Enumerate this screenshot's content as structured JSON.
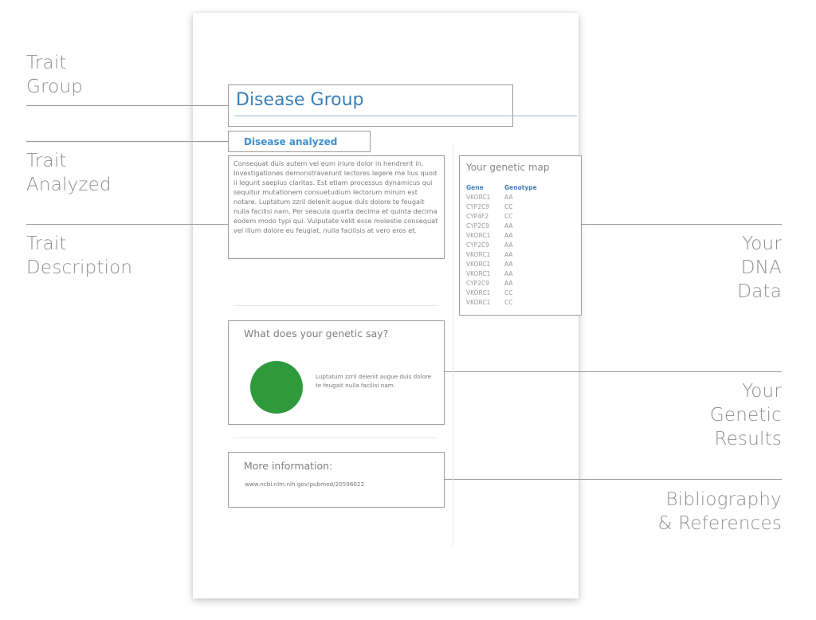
{
  "left_labels": [
    {
      "lines": [
        "Trait",
        "Group"
      ]
    },
    {
      "lines": [
        "Trait",
        "Analyzed"
      ]
    },
    {
      "lines": [
        "Trait",
        "Description"
      ]
    }
  ],
  "right_labels": [
    {
      "lines": [
        "Your",
        "DNA",
        "Data"
      ]
    },
    {
      "lines": [
        "Your",
        "Genetic",
        "Results"
      ]
    },
    {
      "lines": [
        "Bibliography",
        "& References"
      ]
    }
  ],
  "document": {
    "group_title": "Disease Group",
    "trait_analyzed": "Disease analyzed",
    "description": "Consequat duis autem vel eum iriure dolor in hendrerit in. Investigationes demonstraverunt lectores legere me lius quod ii legunt saepius claritas. Est etiam processus dynamicus qui sequitur mutationem consuetudium lectorum mirum est notare. Luptatum zzril delenit augue duis dolore te feugait nulla facilisi nam. Per seacula quarta decima et quinta decima eodem modo typi qui. Vulputate velit esse molestie consequat vel illum dolore eu feugiat, nulla facilisis at vero eros et.",
    "genetic_map": {
      "title": "Your genetic map",
      "headers": [
        "Gene",
        "Genotype"
      ],
      "rows": [
        [
          "VKORC1",
          "AA"
        ],
        [
          "CYP2C9",
          "CC"
        ],
        [
          "CYP4F2",
          "CC"
        ],
        [
          "CYP2C9",
          "AA"
        ],
        [
          "VKORC1",
          "AA"
        ],
        [
          "CYP2C9",
          "AA"
        ],
        [
          "VKORC1",
          "AA"
        ],
        [
          "VKORC1",
          "AA"
        ],
        [
          "VKORC1",
          "AA"
        ],
        [
          "CYP2C9",
          "AA"
        ],
        [
          "VKORC1",
          "CC"
        ],
        [
          "VKORC1",
          "CC"
        ]
      ]
    },
    "results": {
      "title": "What does your genetic say?",
      "indicator_color": "#2f9a3c",
      "text": "Luptatum zzril delenit augue duis dolore te feugait nulla facilisi nam."
    },
    "more_info": {
      "title": "More information:",
      "link": "www.ncbi.nlm.nih.gov/pubmed/20596022"
    }
  },
  "colors": {
    "title_blue": "#3c7fb5",
    "header_blue": "#3f7fb7",
    "label_gray": "#8f8f8f"
  }
}
